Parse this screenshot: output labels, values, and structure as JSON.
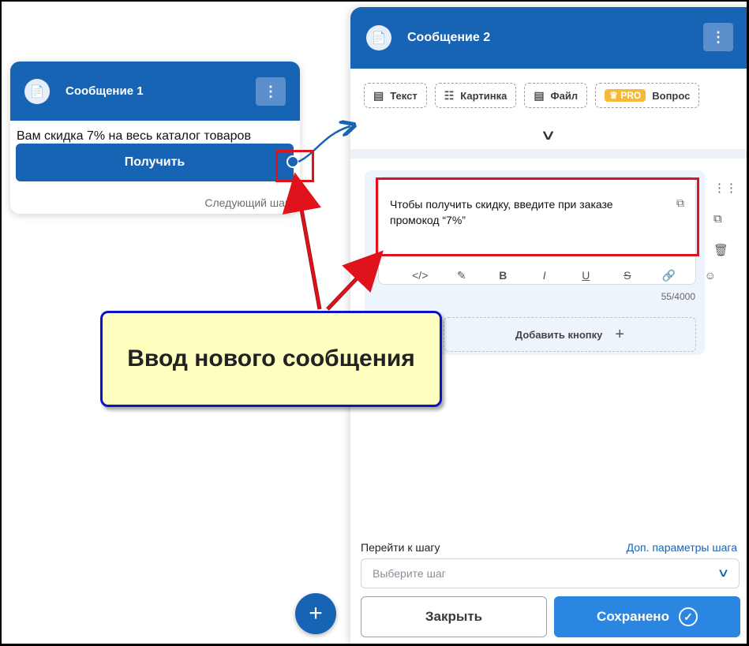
{
  "card1": {
    "title": "Сообщение 1",
    "message": "Вам скидка 7% на весь каталог товаров",
    "button_label": "Получить",
    "next_step_label": "Следующий шаг"
  },
  "panel": {
    "title": "Сообщение 2",
    "tools": [
      {
        "label": "Текст",
        "icon": "text-doc-icon"
      },
      {
        "label": "Картинка",
        "icon": "image-icon"
      },
      {
        "label": "Файл",
        "icon": "file-icon"
      },
      {
        "label": "Вопрос",
        "icon": "question-icon",
        "badge": "PRO"
      }
    ],
    "editor": {
      "text": "Чтобы получить скидку, введите при заказе промокод “7%”",
      "counter": "55/4000",
      "format_tools": [
        "code-icon",
        "magic-pen-icon",
        "bold-icon",
        "italic-icon",
        "underline-icon",
        "strikethrough-icon",
        "link-icon",
        "emoji-icon"
      ]
    },
    "add_button_label": "Добавить кнопку",
    "goto_label": "Перейти к шагу",
    "goto_link": "Доп. параметры шага",
    "select_placeholder": "Выберите шаг",
    "close_label": "Закрыть",
    "saved_label": "Сохранено"
  },
  "annotation": {
    "callout_text": "Ввод нового сообщения"
  },
  "colors": {
    "primary": "#1763b4",
    "saved": "#2a86e0",
    "highlight": "#e0121b",
    "callout_border": "#0b14c9",
    "callout_fill": "#ffffc0",
    "pro": "#f6b93b"
  }
}
